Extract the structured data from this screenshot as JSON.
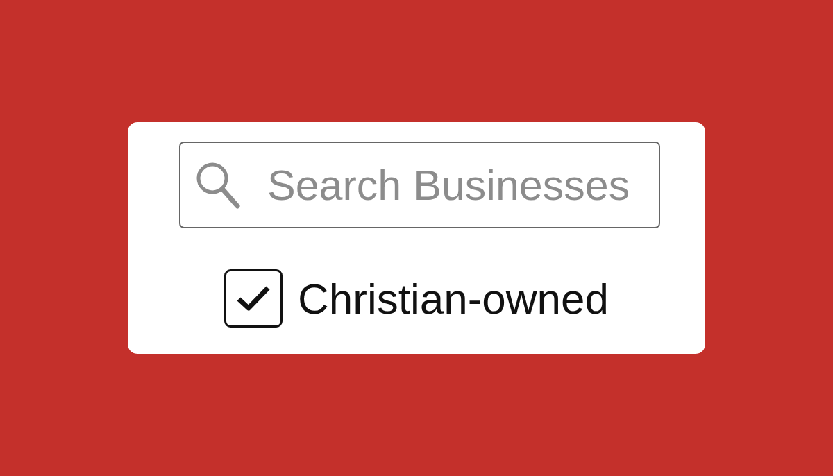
{
  "search": {
    "placeholder": "Search Businesses"
  },
  "filter": {
    "label": "Christian-owned",
    "checked": true
  }
}
